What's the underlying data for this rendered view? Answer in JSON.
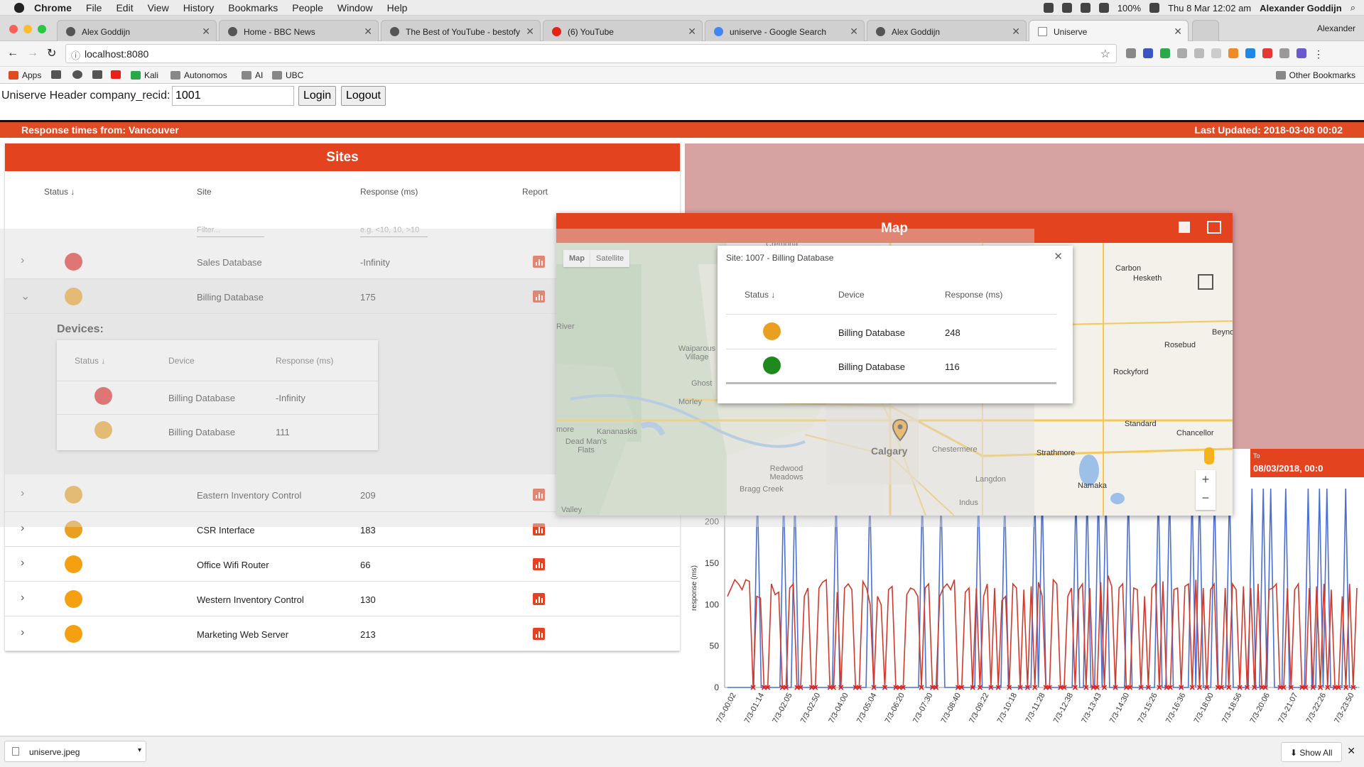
{
  "menubar": {
    "app": "Chrome",
    "items": [
      "File",
      "Edit",
      "View",
      "History",
      "Bookmarks",
      "People",
      "Window",
      "Help"
    ],
    "battery": "100%",
    "datetime": "Thu 8 Mar  12:02 am",
    "user": "Alexander Goddijn"
  },
  "tabs": [
    {
      "title": "Alex Goddijn"
    },
    {
      "title": "Home - BBC News"
    },
    {
      "title": "The Best of YouTube - bestofy"
    },
    {
      "title": "(6) YouTube"
    },
    {
      "title": "uniserve - Google Search"
    },
    {
      "title": "Alex Goddijn"
    },
    {
      "title": "Uniserve"
    }
  ],
  "profile": "Alexander",
  "address": {
    "url": "localhost:8080"
  },
  "bookmarks": {
    "items": [
      "Apps",
      "Kali",
      "Autonomos",
      "AI",
      "UBC"
    ],
    "other": "Other Bookmarks"
  },
  "header": {
    "label": "Uniserve Header company_recid:",
    "company_recid": "1001",
    "login": "Login",
    "logout": "Logout"
  },
  "status_strip": {
    "left": "Response times from: Vancouver",
    "right": "Last Updated: 2018-03-08 00:02"
  },
  "sites": {
    "title": "Sites",
    "columns": {
      "status": "Status",
      "site": "Site",
      "response": "Response (ms)",
      "report": "Report"
    },
    "filter_placeholder": "Filter...",
    "response_placeholder": "e.g. <10, 10, >10",
    "rows": [
      {
        "name": "Sales Database",
        "response": "-Infinity",
        "color": "#e02424"
      },
      {
        "name": "Billing Database",
        "response": "175",
        "color": "#e9a020"
      },
      {
        "name": "Eastern Inventory Control",
        "response": "209",
        "color": "#e9a020"
      },
      {
        "name": "CSR Interface",
        "response": "183",
        "color": "#e9a020"
      },
      {
        "name": "Office Wifi Router",
        "response": "66",
        "color": "#f5a010"
      },
      {
        "name": "Western Inventory Control",
        "response": "130",
        "color": "#f5a010"
      },
      {
        "name": "Marketing Web Server",
        "response": "213",
        "color": "#f5a010"
      }
    ],
    "devices": {
      "title": "Devices:",
      "columns": {
        "status": "Status",
        "device": "Device",
        "response": "Response (ms)"
      },
      "rows": [
        {
          "name": "Billing Database",
          "response": "-Infinity",
          "color": "#e02424"
        },
        {
          "name": "Billing Database",
          "response": "111",
          "color": "#e9a020"
        }
      ]
    }
  },
  "map": {
    "title": "Map",
    "type_map": "Map",
    "type_satellite": "Satellite",
    "pin_label": "Calgary",
    "towns": [
      "Cremona",
      "Carbon",
      "Hesketh",
      "Beynon",
      "Rosebud",
      "Rockyford",
      "River",
      "Waiparous Village",
      "Ghost",
      "Morley",
      "Kananaskis",
      "Dead Man's Flats",
      "Redwood Meadows",
      "Bragg Creek",
      "Chestermere",
      "Langdon",
      "Indus",
      "Strathmore",
      "Namaka",
      "Standard",
      "Chancellor",
      "more",
      "Valley"
    ],
    "infowindow": {
      "title": "Site: 1007 - Billing Database",
      "columns": {
        "status": "Status",
        "device": "Device",
        "response": "Response (ms)"
      },
      "rows": [
        {
          "name": "Billing Database",
          "response": "248",
          "color": "#e9a020"
        },
        {
          "name": "Billing Database",
          "response": "116",
          "color": "#1e8a1e"
        }
      ]
    }
  },
  "date_range": {
    "to_label": "To",
    "to_value": "08/03/2018, 00:0"
  },
  "chart_data": {
    "type": "line",
    "ylabel": "response (ms)",
    "xlabel": "",
    "ylim": [
      0,
      240
    ],
    "yticks": [
      0,
      50,
      100,
      150,
      200
    ],
    "xticks": [
      "7/3-00:02",
      "7/3-01:14",
      "7/3-02:05",
      "7/3-02:50",
      "7/3-04:00",
      "7/3-05:04",
      "7/3-06:20",
      "7/3-07:30",
      "7/3-08:40",
      "7/3-09:22",
      "7/3-10:18",
      "7/3-11:28",
      "7/3-12:38",
      "7/3-13:43",
      "7/3-14:30",
      "7/3-15:26",
      "7/3-16:36",
      "7/3-18:00",
      "7/3-18:56",
      "7/3-20:06",
      "7/3-21:07",
      "7/3-22:26",
      "7/3-23:50"
    ],
    "series": [
      {
        "color": "#4a6fd0",
        "values": [
          0,
          0,
          0,
          0,
          0,
          0,
          0,
          0,
          240,
          0,
          0,
          0,
          0,
          0,
          0,
          240,
          0,
          0,
          240,
          0,
          0,
          0,
          0,
          0,
          0,
          0,
          0,
          0,
          0,
          240,
          0,
          0,
          0,
          0,
          0,
          0,
          0,
          0,
          240,
          0,
          0,
          0,
          0,
          0,
          0,
          0,
          0,
          0,
          0,
          0,
          0,
          0,
          240,
          0,
          0,
          0,
          0,
          240,
          0,
          0,
          0,
          0,
          0,
          0,
          0,
          0,
          0,
          240,
          0,
          0,
          0,
          0,
          0,
          0,
          240,
          0,
          0,
          0,
          0,
          0,
          0,
          0,
          240,
          0,
          240,
          0,
          0,
          0,
          0,
          0,
          0,
          0,
          0,
          240,
          0,
          0,
          240,
          0,
          0,
          240,
          0,
          240,
          0,
          0,
          0,
          0,
          0,
          240,
          0,
          0,
          0,
          0,
          0,
          0,
          0,
          240,
          0,
          0,
          240,
          0,
          0,
          0,
          0,
          0,
          240,
          0,
          240,
          0,
          0,
          0,
          240,
          0,
          0,
          0,
          240,
          0,
          0,
          0,
          0,
          0,
          240,
          0,
          0,
          240,
          0,
          240,
          0,
          0,
          0,
          240,
          0,
          0,
          0,
          0,
          0,
          240,
          0,
          0,
          240,
          0,
          240,
          0,
          0,
          0,
          0,
          240,
          0,
          0,
          0
        ]
      },
      {
        "color": "#d03a2a",
        "values": [
          110,
          120,
          130,
          125,
          118,
          130,
          128,
          0,
          110,
          108,
          0,
          0,
          125,
          112,
          115,
          0,
          0,
          120,
          125,
          0,
          0,
          110,
          120,
          0,
          0,
          120,
          127,
          130,
          0,
          0,
          115,
          0,
          120,
          125,
          118,
          0,
          0,
          128,
          120,
          100,
          0,
          110,
          100,
          0,
          118,
          122,
          0,
          0,
          0,
          112,
          120,
          118,
          110,
          0,
          120,
          125,
          0,
          0,
          110,
          120,
          125,
          118,
          130,
          0,
          0,
          115,
          120,
          0,
          120,
          0,
          110,
          125,
          0,
          120,
          0,
          105,
          110,
          0,
          125,
          120,
          0,
          118,
          0,
          122,
          0,
          127,
          110,
          0,
          0,
          130,
          125,
          0,
          0,
          110,
          120,
          0,
          118,
          125,
          0,
          120,
          0,
          0,
          127,
          0,
          135,
          122,
          0,
          120,
          125,
          0,
          0,
          120,
          118,
          0,
          110,
          0,
          120,
          125,
          0,
          128,
          0,
          0,
          118,
          120,
          0,
          122,
          125,
          0,
          130,
          0,
          120,
          0,
          118,
          125,
          0,
          0,
          120,
          0,
          125,
          118,
          0,
          122,
          0,
          120,
          0,
          125,
          0,
          0,
          118,
          120,
          125,
          0,
          0,
          120,
          0,
          118,
          125,
          0,
          0,
          120,
          0,
          122,
          0,
          125,
          0,
          118,
          0,
          0,
          110,
          0,
          125,
          0,
          120
        ]
      }
    ]
  },
  "download": {
    "file": "uniserve.jpeg",
    "show_all": "Show All"
  }
}
